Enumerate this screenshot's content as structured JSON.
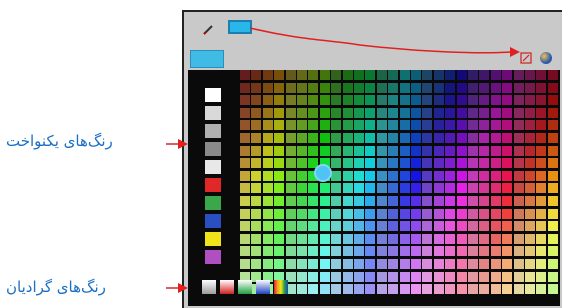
{
  "labels": {
    "solid_colors": "رنگ‌های یکنواخت",
    "gradient_colors": "رنگ‌های گرادیان"
  },
  "toolbar": {
    "pencil_icon": "pencil-icon",
    "current_color": "#29b6e8"
  },
  "colors": {
    "accent": "#3fbbe6",
    "arrow": "#e02020",
    "label": "#1a6fc4"
  },
  "solid_swatches": [
    "#ffffff",
    "#d9d9d9",
    "#b0b0b0",
    "#8a8a8a",
    "#e8e8e8",
    "#e02828",
    "#3aa84a",
    "#2a4fc0",
    "#f2e21a",
    "#b04fc0"
  ],
  "gradient_swatches": [
    "#9a9a9a",
    "#d02020",
    "#20a040",
    "#2040c0",
    "#e0a020"
  ]
}
